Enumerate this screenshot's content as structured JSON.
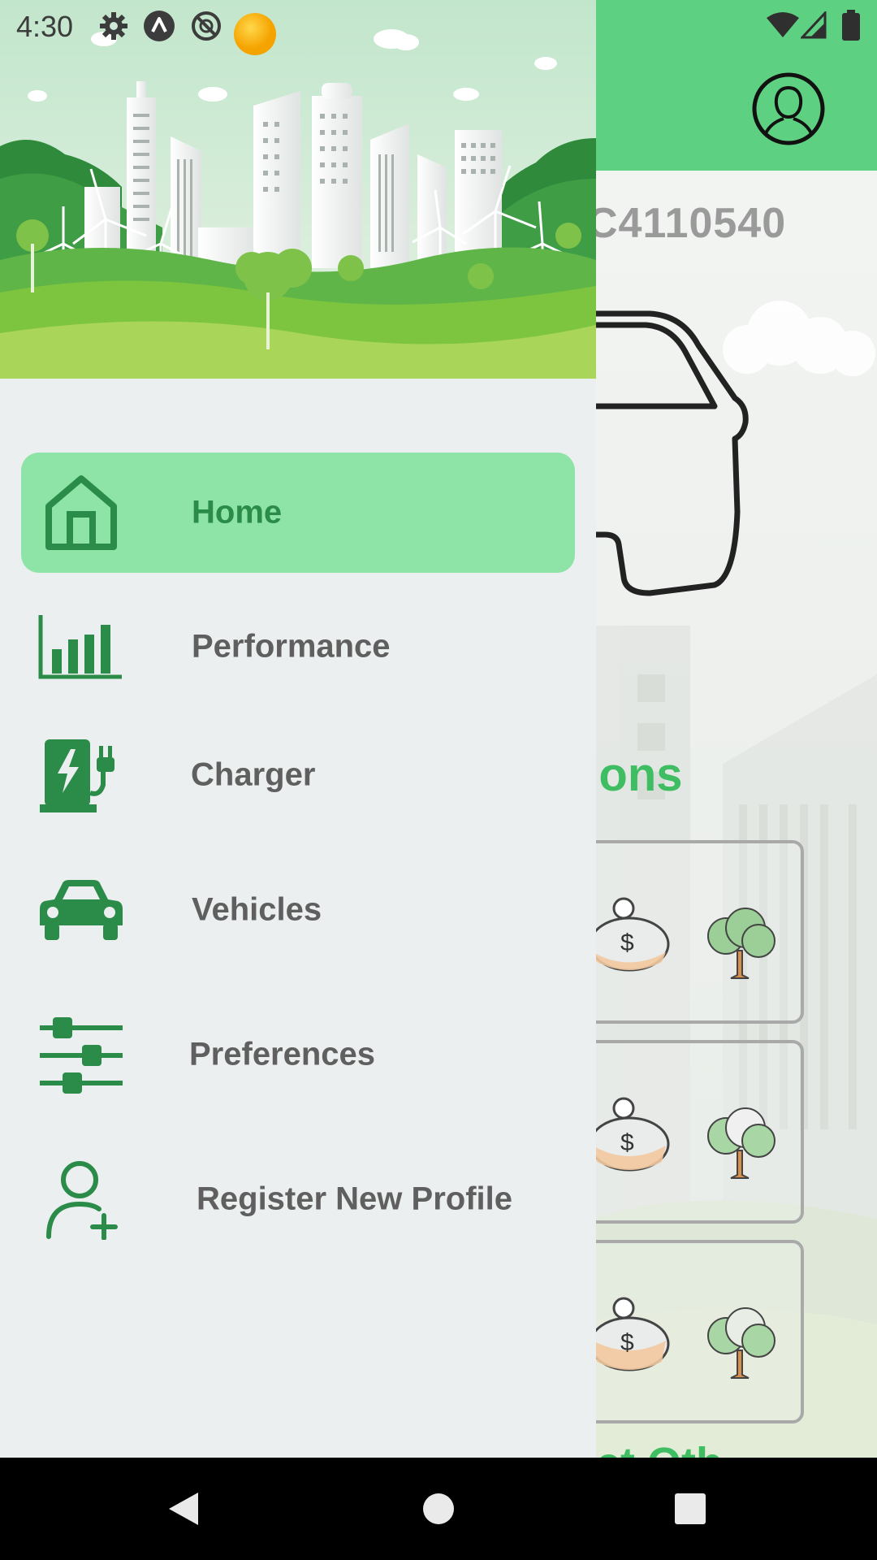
{
  "status_bar": {
    "time": "4:30",
    "icons_left": [
      "settings-icon",
      "app-a-icon",
      "no-signal-circle-icon",
      "sun-icon"
    ],
    "icons_right": [
      "wifi-icon",
      "cell-signal-icon",
      "battery-icon"
    ]
  },
  "background_app": {
    "vehicle_id": "C4110540",
    "section_title": "tions",
    "bottom_title": "ct Oth",
    "colors": {
      "topbar": "#5ed081",
      "accent": "#3fbd62"
    }
  },
  "drawer": {
    "items": [
      {
        "label": "Home",
        "icon": "home-icon",
        "active": true
      },
      {
        "label": "Performance",
        "icon": "bar-chart-icon",
        "active": false
      },
      {
        "label": "Charger",
        "icon": "ev-charger-icon",
        "active": false
      },
      {
        "label": "Vehicles",
        "icon": "car-icon",
        "active": false
      },
      {
        "label": "Preferences",
        "icon": "sliders-icon",
        "active": false
      },
      {
        "label": "Register New Profile",
        "icon": "add-user-icon",
        "active": false
      }
    ],
    "colors": {
      "active_bg": "#8ee4a6",
      "icon": "#2b8c49",
      "label": "#5f5f5f"
    }
  },
  "nav_bar": {
    "buttons": [
      "back-icon",
      "home-circle-icon",
      "recents-icon"
    ]
  }
}
